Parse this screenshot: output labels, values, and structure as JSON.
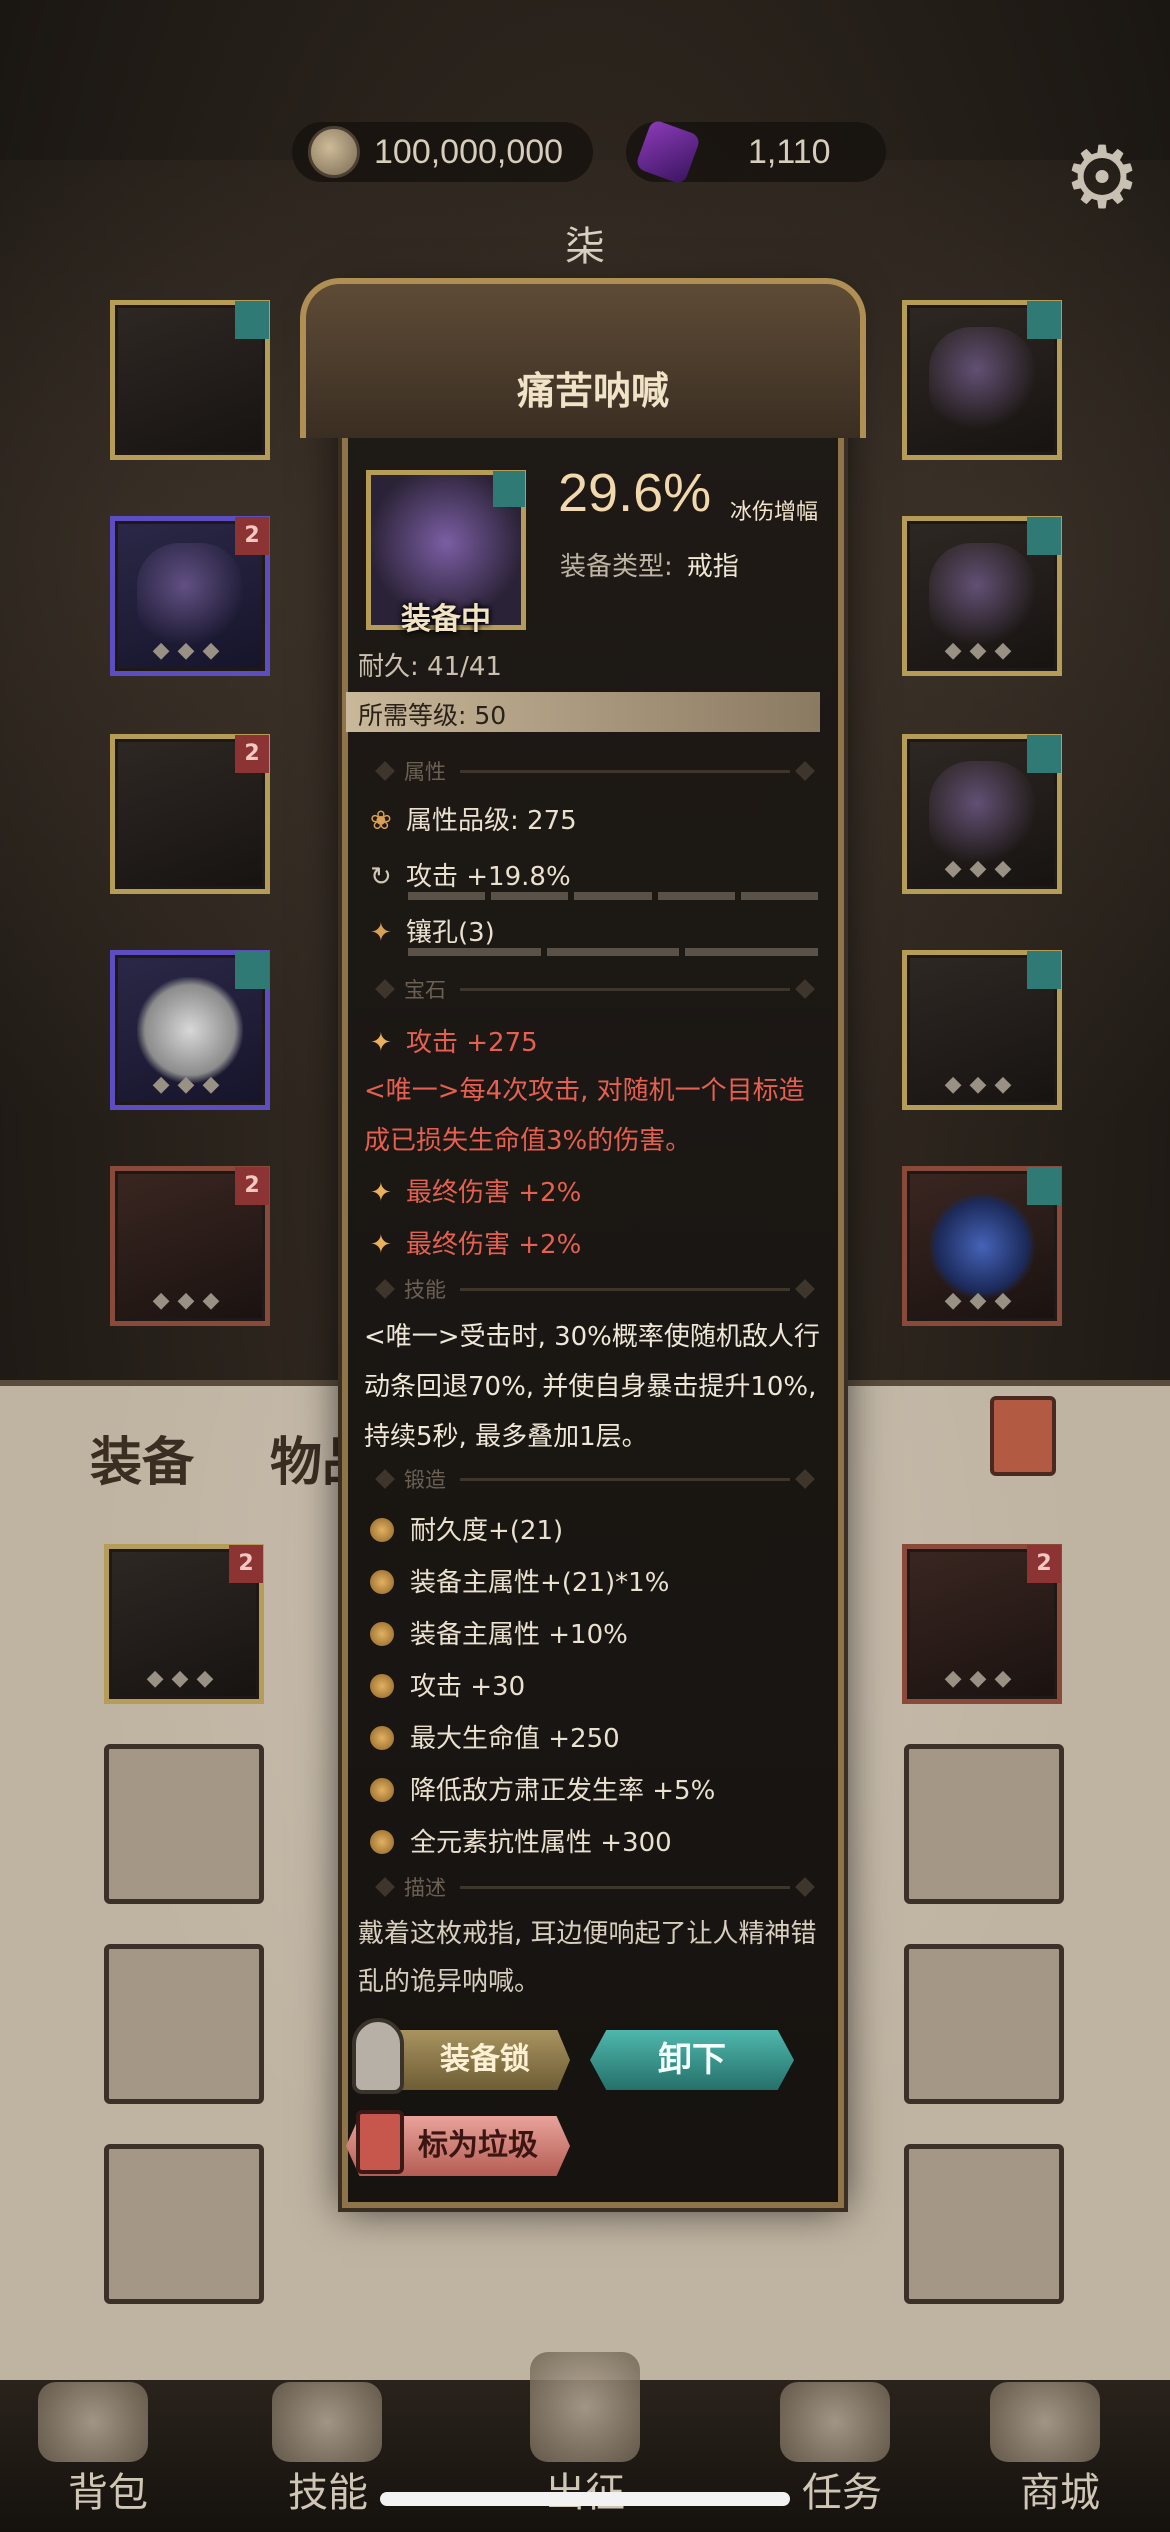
{
  "currency": {
    "coins": "100,000,000",
    "gems": "1,110"
  },
  "section_tag": "柒",
  "bag": {
    "tab_equipment": "装备",
    "tab_items": "物品"
  },
  "tooltip": {
    "title": "痛苦呐喊",
    "equipped_label": "装备中",
    "stat_value": "29.6%",
    "stat_label": "冰伤增幅",
    "type_label": "装备类型:",
    "type_value": "戒指",
    "durability": "耐久: 41/41",
    "level_req": "所需等级: 50",
    "sections": {
      "attributes": "属性",
      "gems": "宝石",
      "skills": "技能",
      "forge": "锻造",
      "description": "描述"
    },
    "attr_grade": "属性品级: 275",
    "attr_attack": "攻击 +19.8%",
    "attr_sockets": "镶孔(3)",
    "gem_attack": "攻击 +275",
    "gem_unique": "<唯一>每4次攻击, 对随机一个目标造成已损失生命值3%的伤害。",
    "gem_final_1": "最终伤害 +2%",
    "gem_final_2": "最终伤害 +2%",
    "skill_text": "<唯一>受击时, 30%概率使随机敌人行动条回退70%, 并使自身暴击提升10%, 持续5秒, 最多叠加1层。",
    "forge": [
      "耐久度+(21)",
      "装备主属性+(21)*1%",
      "装备主属性 +10%",
      "攻击 +30",
      "最大生命值 +250",
      "降低敌方肃正发生率 +5%",
      "全元素抗性属性 +300"
    ],
    "description": "戴着这枚戒指, 耳边便响起了让人精神错乱的诡异呐喊。",
    "btn_lock": "装备锁",
    "btn_unequip": "卸下",
    "btn_junk": "标为垃圾"
  },
  "nav": {
    "bag": "背包",
    "skills": "技能",
    "expedition": "出征",
    "tasks": "任务",
    "shop": "商城"
  },
  "colors": {
    "accent_gold": "#b69d57",
    "unique_red": "#e56050",
    "teal": "#2f7a74"
  }
}
